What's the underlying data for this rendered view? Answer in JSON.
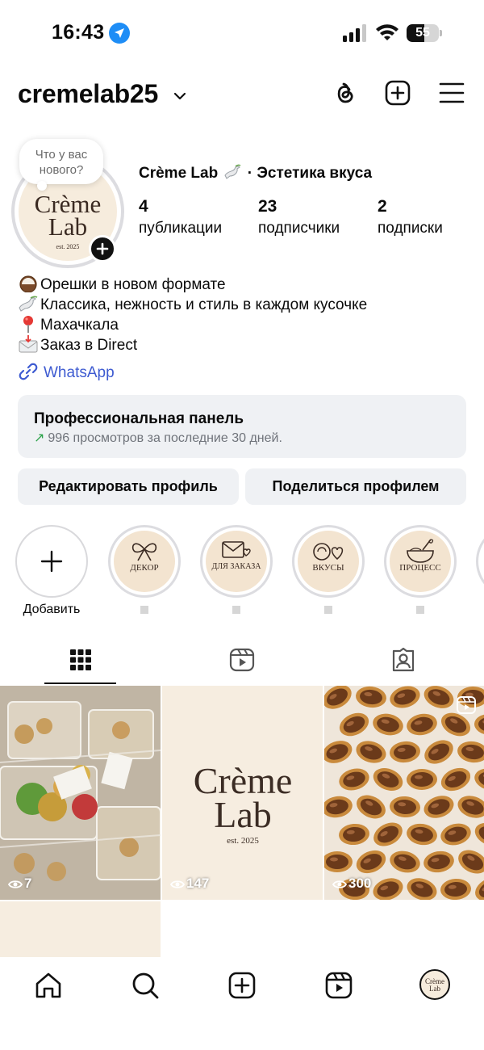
{
  "status_bar": {
    "time": "16:43",
    "battery": "55",
    "battery_level": 0.55
  },
  "header": {
    "username": "cremelab25"
  },
  "profile": {
    "avatar_logo_line1": "Crème",
    "avatar_logo_line2": "Lab",
    "avatar_logo_est": "est. 2025",
    "note_bubble": "Что у вас нового?",
    "display_name": "Crème Lab",
    "tagline": "· Эстетика вкуса",
    "stats": [
      {
        "value": "4",
        "label": "публикации"
      },
      {
        "value": "23",
        "label": "подписчики"
      },
      {
        "value": "2",
        "label": "подписки"
      }
    ],
    "bio": [
      "Орешки в новом формате",
      "Классика, нежность и стиль в каждом кусочке",
      "Махачкала",
      "Заказ в Direct"
    ],
    "link_text": "WhatsApp"
  },
  "pro_panel": {
    "title": "Профессиональная панель",
    "subtitle": "996 просмотров за последние 30 дней."
  },
  "buttons": {
    "edit_profile": "Редактировать профиль",
    "share_profile": "Поделиться профилем"
  },
  "highlights": [
    {
      "label": "Добавить",
      "kind": "add"
    },
    {
      "label": "ДЕКОР",
      "icon": "bow-icon"
    },
    {
      "label": "ДЛЯ ЗАКАЗА",
      "icon": "envelope-heart-icon"
    },
    {
      "label": "ВКУСЫ",
      "icon": "coconut-heart-icon"
    },
    {
      "label": "ПРОЦЕСС",
      "icon": "mixing-bowl-icon"
    }
  ],
  "tabs": [
    "grid-icon",
    "reels-icon",
    "tagged-icon"
  ],
  "posts": [
    {
      "views": "7",
      "kind": "photo"
    },
    {
      "views": "147",
      "kind": "logo",
      "logo_line1": "Crème",
      "logo_line2": "Lab",
      "logo_est": "est. 2025"
    },
    {
      "views": "300",
      "kind": "reel"
    }
  ],
  "bottom_nav": {
    "items": [
      "home-icon",
      "search-icon",
      "create-icon",
      "reels-icon",
      "profile-avatar"
    ],
    "avatar_line1": "Crème",
    "avatar_line2": "Lab"
  },
  "colors": {
    "link": "#3e5bd1",
    "panel_bg": "#eff1f4",
    "trend_green": "#2aa148",
    "brand_bg": "#f6ecdd",
    "brand_text": "#3a2a22"
  }
}
